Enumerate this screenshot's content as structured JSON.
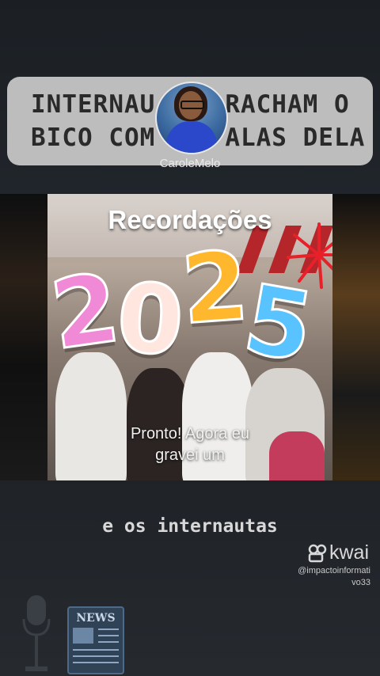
{
  "banner": {
    "line1": "INTERNAU",
    "line1_right": "RACHAM O",
    "line2": "BICO COM",
    "line2_right": "ALAS DELA"
  },
  "profile": {
    "username": "CaroleMelo"
  },
  "video": {
    "overlay_title": "Recordações",
    "year": [
      "2",
      "0",
      "2",
      "5"
    ],
    "caption_line1": "Pronto! Agora eu",
    "caption_line2": "gravei um"
  },
  "subtitle": "e os internautas",
  "watermark": {
    "brand": "kwai",
    "handle_line1": "@impactoinformati",
    "handle_line2": "vo33"
  },
  "icons": {
    "microphone": "microphone-icon",
    "news": "news-icon"
  },
  "colors": {
    "digit1": "#f08ad6",
    "digit2": "#ffe7e0",
    "digit3": "#ffb72e",
    "digit4": "#59c3ff"
  },
  "news_label": "NEWS"
}
